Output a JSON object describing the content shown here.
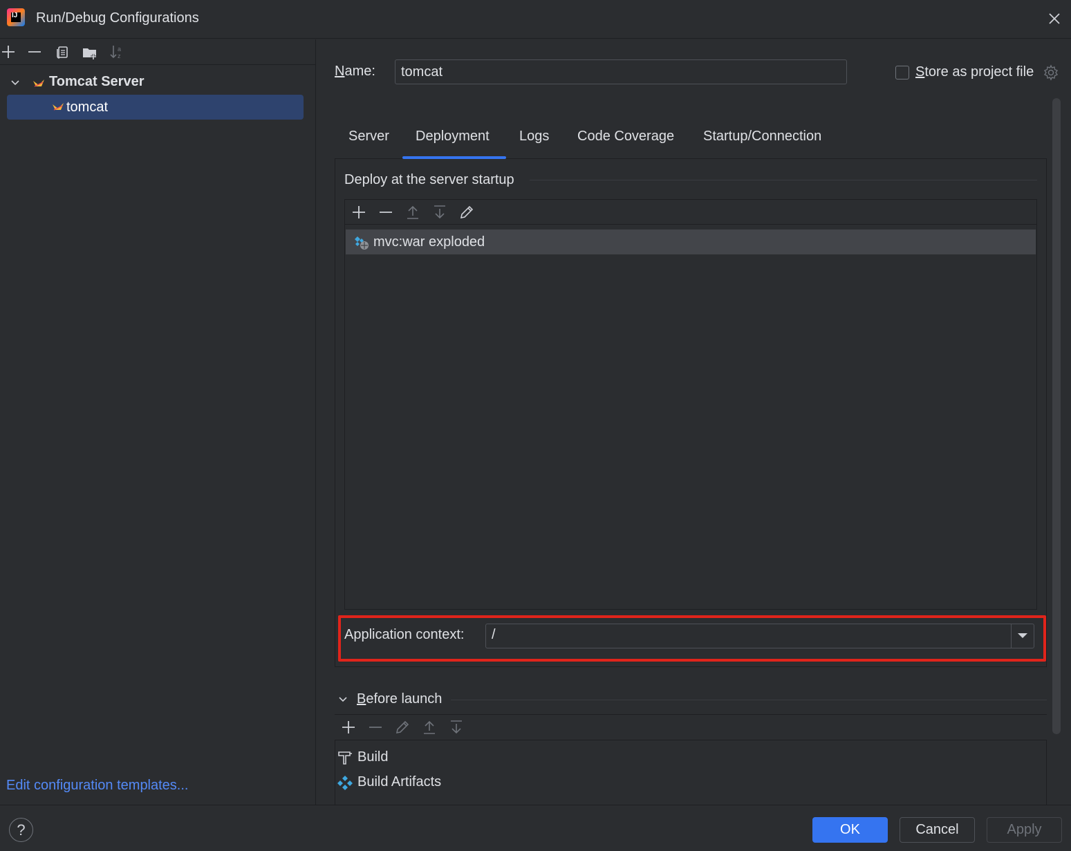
{
  "window": {
    "title": "Run/Debug Configurations"
  },
  "left_toolbar": {
    "icons": [
      "add-icon",
      "remove-icon",
      "copy-icon",
      "new-folder-icon",
      "sort-icon"
    ]
  },
  "tree": {
    "group_label": "Tomcat Server",
    "items": [
      {
        "label": "tomcat",
        "selected": true
      }
    ]
  },
  "edit_templates_link": "Edit configuration templates...",
  "name_field": {
    "label_first": "N",
    "label_rest": "ame:",
    "value": "tomcat"
  },
  "store_as_project": {
    "label_first": "S",
    "label_rest": "tore as project file",
    "checked": false
  },
  "tabs": [
    {
      "label": "Server",
      "active": false
    },
    {
      "label": "Deployment",
      "active": true
    },
    {
      "label": "Logs",
      "active": false
    },
    {
      "label": "Code Coverage",
      "active": false
    },
    {
      "label": "Startup/Connection",
      "active": false
    }
  ],
  "deployment": {
    "section_title": "Deploy at the server startup",
    "artifacts": [
      {
        "label": "mvc:war exploded"
      }
    ],
    "app_context_label": "Application context:",
    "app_context_value": "/"
  },
  "before_launch": {
    "title_first": "B",
    "title_rest": "efore launch",
    "items": [
      {
        "label": "Build",
        "icon": "build-icon"
      },
      {
        "label": "Build Artifacts",
        "icon": "build-artifacts-icon"
      }
    ]
  },
  "buttons": {
    "help": "?",
    "ok": "OK",
    "cancel": "Cancel",
    "apply": "Apply"
  },
  "colors": {
    "accent": "#3574f0",
    "highlight_box": "#e0241b",
    "selection": "#2e436e",
    "link": "#548af7"
  }
}
